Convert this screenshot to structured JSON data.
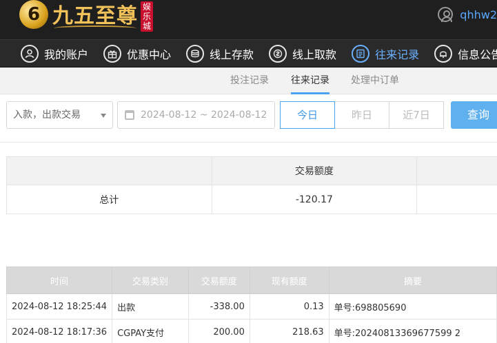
{
  "brand": {
    "logo_text": "九五至尊",
    "seal_chars": [
      "娱",
      "乐",
      "城"
    ],
    "badge_glyph": "6"
  },
  "user": {
    "username": "qhhw2"
  },
  "main_nav": [
    {
      "label": "我的账户",
      "icon": "user-icon",
      "active": false
    },
    {
      "label": "优惠中心",
      "icon": "gift-icon",
      "active": false
    },
    {
      "label": "线上存款",
      "icon": "deposit-icon",
      "active": false
    },
    {
      "label": "线上取款",
      "icon": "withdraw-icon",
      "active": false
    },
    {
      "label": "往来记录",
      "icon": "records-icon",
      "active": true
    },
    {
      "label": "信息公告",
      "icon": "bell-icon",
      "active": false
    }
  ],
  "sub_nav": [
    {
      "label": "投注记录",
      "active": false
    },
    {
      "label": "往来记录",
      "active": true
    },
    {
      "label": "处理中订单",
      "active": false
    }
  ],
  "filters": {
    "type_select": "入款，出款交易",
    "date_range": "2024-08-12 ~ 2024-08-12",
    "quick_buttons": [
      {
        "label": "今日",
        "active": true
      },
      {
        "label": "昨日",
        "active": false
      },
      {
        "label": "近7日",
        "active": false
      }
    ],
    "search_label": "查询"
  },
  "summary": {
    "header": "交易额度",
    "row_label": "总计",
    "total": "-120.17"
  },
  "records": {
    "columns": [
      "时间",
      "交易类别",
      "交易额度",
      "现有额度",
      "摘要"
    ],
    "rows": [
      {
        "time": "2024-08-12 18:25:44",
        "type": "出款",
        "amount": "-338.00",
        "balance": "0.13",
        "memo": "单号:698805690"
      },
      {
        "time": "2024-08-12 18:17:36",
        "type": "CGPAY支付",
        "amount": "200.00",
        "balance": "218.63",
        "memo": "单号:20240813369677599 2"
      }
    ]
  },
  "colors": {
    "accent": "#4aa3f0",
    "search_button": "#5fb0ef",
    "topbar": "#1f1f1f",
    "nav_active": "#6bb1ff"
  }
}
